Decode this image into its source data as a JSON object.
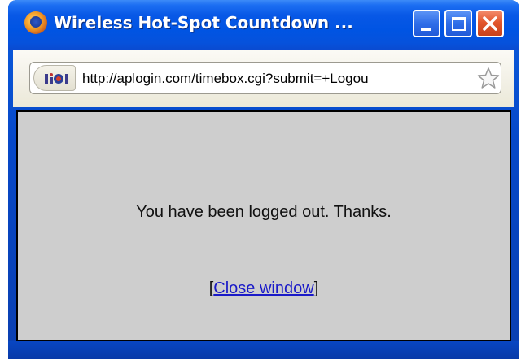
{
  "window": {
    "title": "Wireless Hot-Spot Countdown ...",
    "controls": {
      "minimize": "minimize",
      "maximize": "maximize",
      "close": "close"
    }
  },
  "address_bar": {
    "url": "http://aplogin.com/timebox.cgi?submit=+Logou",
    "site_icon": "site-identity-icon",
    "bookmark_icon": "star-icon"
  },
  "content": {
    "message": "You have been logged out. Thanks.",
    "close_prefix": "[",
    "close_link": "Close window",
    "close_suffix": "]"
  },
  "colors": {
    "titlebar": "#0054e3",
    "content_bg": "#cecece",
    "link": "#1a1ac8",
    "close_button": "#e2562c"
  }
}
